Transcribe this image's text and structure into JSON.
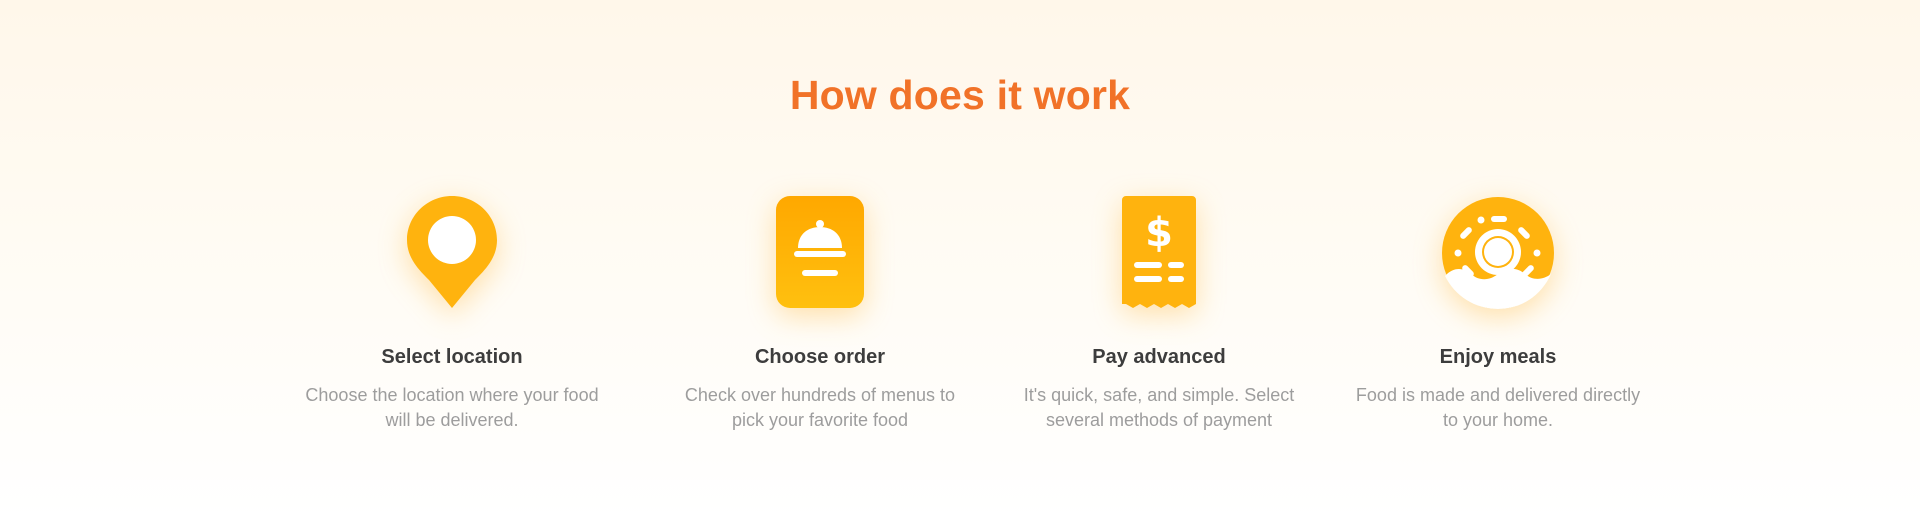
{
  "section": {
    "title": "How does it work"
  },
  "colors": {
    "title": "#f17228",
    "icon": "#ffb30e",
    "heading": "#3d3d3d",
    "text": "#9d9d9d"
  },
  "steps": [
    {
      "icon": "location-pin-icon",
      "title": "Select location",
      "description": "Choose the location where your food will be delivered."
    },
    {
      "icon": "food-order-icon",
      "title": "Choose order",
      "description": "Check over hundreds of menus to pick your favorite food"
    },
    {
      "icon": "receipt-dollar-icon",
      "title": "Pay advanced",
      "description": "It's quick, safe, and simple. Select several methods of payment"
    },
    {
      "icon": "donut-icon",
      "title": "Enjoy meals",
      "description": "Food is made and delivered directly to your home."
    }
  ]
}
